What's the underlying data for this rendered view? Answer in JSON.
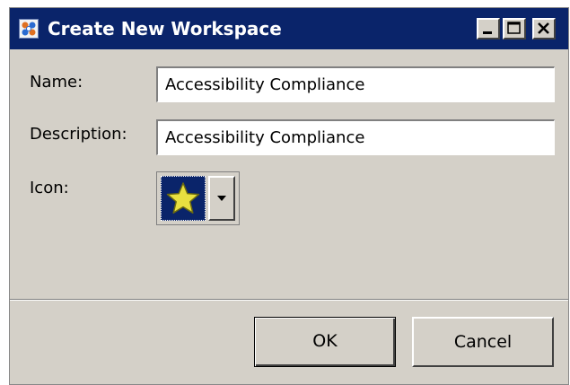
{
  "window": {
    "title": "Create New Workspace",
    "app_icon": "workspace-app-icon",
    "controls": {
      "minimize_icon": "minimize-icon",
      "maximize_icon": "maximize-icon",
      "close_icon": "close-icon"
    }
  },
  "form": {
    "name_label": "Name:",
    "name_value": "Accessibility Compliance",
    "description_label": "Description:",
    "description_value": "Accessibility Compliance",
    "icon_label": "Icon:",
    "icon_selected": "star-icon"
  },
  "buttons": {
    "ok_label": "OK",
    "cancel_label": "Cancel"
  },
  "colors": {
    "titlebar": "#0a246a",
    "dialog_bg": "#d4d0c8",
    "star": "#e8e040"
  }
}
